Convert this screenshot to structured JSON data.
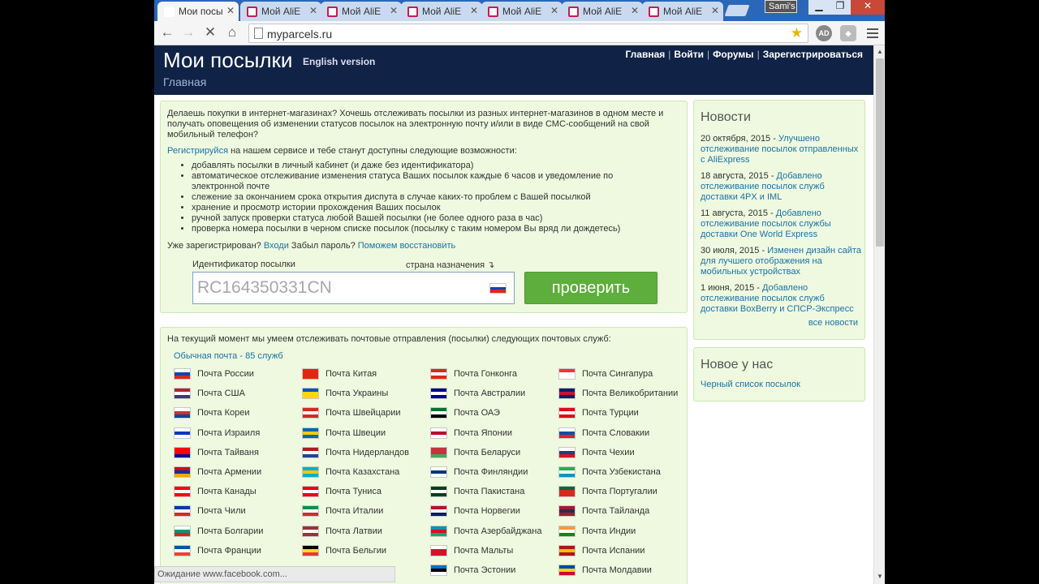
{
  "browser": {
    "tabs": [
      {
        "title": "Мои посы",
        "active": true
      },
      {
        "title": "Мой AliE",
        "active": false
      },
      {
        "title": "Мой AliE",
        "active": false
      },
      {
        "title": "Мой AliE",
        "active": false
      },
      {
        "title": "Мой AliE",
        "active": false
      },
      {
        "title": "Мой AliE",
        "active": false
      },
      {
        "title": "Мой AliE",
        "active": false
      }
    ],
    "user_badge": "Sami's",
    "url": "myparcels.ru",
    "status": "Ожидание www.facebook.com..."
  },
  "header": {
    "title": "Мои посылки",
    "english_link": "English version",
    "breadcrumb": "Главная",
    "nav": [
      "Главная",
      "Войти",
      "Форумы",
      "Зарегистрироваться"
    ]
  },
  "intro": {
    "text": "Делаешь покупки в интернет-магазинах? Хочешь отслеживать посылки из разных интернет-магазинов в одном месте и получать оповещения об изменении статусов посылок на электронную почту и/или в виде СМС-сообщений на свой мобильный телефон?",
    "register_link": "Регистрируйся",
    "register_rest": " на нашем сервисе и тебе станут доступны следующие возможности:",
    "features": [
      "добавлять посылки в личный кабинет (и даже без идентификатора)",
      "автоматическое отслеживание изменения статуса Ваших посылок каждые 6 часов и уведомление по электронной почте",
      "слежение за окончанием срока открытия диспута в случае каких-то проблем с Вашей посылкой",
      "хранение и просмотр истории прохождения Ваших посылок",
      "ручной запуск проверки статуса любой Вашей посылки (не более одного раза в час)",
      "проверка номера посылки в черном списке посылок (посылку с таким номером Вы вряд ли дождетесь)"
    ],
    "registered_q": "Уже зарегистрирован? ",
    "login_link": "Входи",
    "forgot_q": " Забыл пароль? ",
    "restore_link": "Поможем восстановить",
    "track_label": "Идентификатор посылки",
    "country_label": "страна назначения ↴",
    "track_placeholder": "RC164350331CN",
    "check_button": "проверить"
  },
  "news": {
    "title": "Новости",
    "items": [
      {
        "date": "20 октября, 2015 - ",
        "text": "Улучшено отслеживание посылок отправленных с AliExpress"
      },
      {
        "date": "18 августа, 2015 - ",
        "text": "Добавлено отслеживание посылок служб доставки 4PX и IML"
      },
      {
        "date": "11 августа, 2015 - ",
        "text": "Добавлено отслеживание посылок службы доставки One World Express"
      },
      {
        "date": "30 июля, 2015 - ",
        "text": "Изменен дизайн сайта для лучшего отображения на мобильных устройствах"
      },
      {
        "date": "1 июня, 2015 - ",
        "text": "Добавлено отслеживание посылок служб доставки BoxBerry и СПСР-Экспресс"
      }
    ],
    "all_link": "все новости"
  },
  "new_with_us": {
    "title": "Новое у нас",
    "link": "Черный список посылок"
  },
  "services": {
    "intro": "На текущий момент мы умеем отслеживать почтовые отправления (посылки) следующих почтовых служб:",
    "sub": "Обычная почта - 85 служб",
    "columns": [
      [
        {
          "name": "Почта России",
          "colors": [
            "#ffffff",
            "#1c3fa8",
            "#d52b1e"
          ]
        },
        {
          "name": "Почта США",
          "colors": [
            "#b22234",
            "#ffffff",
            "#3c3b6e"
          ]
        },
        {
          "name": "Почта Кореи",
          "colors": [
            "#ffffff",
            "#cd2e3a",
            "#0047a0"
          ]
        },
        {
          "name": "Почта Израиля",
          "colors": [
            "#ffffff",
            "#0038b8",
            "#ffffff"
          ]
        },
        {
          "name": "Почта Тайваня",
          "colors": [
            "#fe0000",
            "#fe0000",
            "#000095"
          ]
        },
        {
          "name": "Почта Армении",
          "colors": [
            "#d90012",
            "#0033a0",
            "#f2a800"
          ]
        },
        {
          "name": "Почта Канады",
          "colors": [
            "#ff0000",
            "#ffffff",
            "#ff0000"
          ]
        },
        {
          "name": "Почта Чили",
          "colors": [
            "#0039a6",
            "#ffffff",
            "#d52b1e"
          ]
        },
        {
          "name": "Почта Болгарии",
          "colors": [
            "#ffffff",
            "#00966e",
            "#d62612"
          ]
        },
        {
          "name": "Почта Франции",
          "colors": [
            "#0055a4",
            "#ffffff",
            "#ef4135"
          ]
        }
      ],
      [
        {
          "name": "Почта Китая",
          "colors": [
            "#de2910",
            "#de2910",
            "#de2910"
          ]
        },
        {
          "name": "Почта Украины",
          "colors": [
            "#0057b7",
            "#ffd700",
            "#ffd700"
          ]
        },
        {
          "name": "Почта Швейцарии",
          "colors": [
            "#d52b1e",
            "#ffffff",
            "#d52b1e"
          ]
        },
        {
          "name": "Почта Швеции",
          "colors": [
            "#006aa7",
            "#fecc00",
            "#006aa7"
          ]
        },
        {
          "name": "Почта Нидерландов",
          "colors": [
            "#ae1c28",
            "#ffffff",
            "#21468b"
          ]
        },
        {
          "name": "Почта Казахстана",
          "colors": [
            "#00afca",
            "#fec50c",
            "#00afca"
          ]
        },
        {
          "name": "Почта Туниса",
          "colors": [
            "#e70013",
            "#ffffff",
            "#e70013"
          ]
        },
        {
          "name": "Почта Италии",
          "colors": [
            "#009246",
            "#ffffff",
            "#ce2b37"
          ]
        },
        {
          "name": "Почта Латвии",
          "colors": [
            "#9e3039",
            "#ffffff",
            "#9e3039"
          ]
        },
        {
          "name": "Почта Бельгии",
          "colors": [
            "#000000",
            "#fdda24",
            "#ef3340"
          ]
        }
      ],
      [
        {
          "name": "Почта Гонконга",
          "colors": [
            "#de2910",
            "#ffffff",
            "#de2910"
          ]
        },
        {
          "name": "Почта Австралии",
          "colors": [
            "#00008b",
            "#ffffff",
            "#00008b"
          ]
        },
        {
          "name": "Почта ОАЭ",
          "colors": [
            "#00732f",
            "#ffffff",
            "#000000"
          ]
        },
        {
          "name": "Почта Японии",
          "colors": [
            "#ffffff",
            "#bc002d",
            "#ffffff"
          ]
        },
        {
          "name": "Почта Беларуси",
          "colors": [
            "#c8313e",
            "#c8313e",
            "#4aa657"
          ]
        },
        {
          "name": "Почта Финляндии",
          "colors": [
            "#ffffff",
            "#003580",
            "#ffffff"
          ]
        },
        {
          "name": "Почта Пакистана",
          "colors": [
            "#01411c",
            "#ffffff",
            "#01411c"
          ]
        },
        {
          "name": "Почта Норвегии",
          "colors": [
            "#ba0c2f",
            "#ffffff",
            "#00205b"
          ]
        },
        {
          "name": "Почта Азербайджана",
          "colors": [
            "#0092bc",
            "#e4002b",
            "#00af66"
          ]
        },
        {
          "name": "Почта Мальты",
          "colors": [
            "#ffffff",
            "#cf142b",
            "#cf142b"
          ]
        },
        {
          "name": "Почта Эстонии",
          "colors": [
            "#0072ce",
            "#000000",
            "#ffffff"
          ]
        }
      ],
      [
        {
          "name": "Почта Сингапура",
          "colors": [
            "#ef3340",
            "#ffffff",
            "#ffffff"
          ]
        },
        {
          "name": "Почта Великобритании",
          "colors": [
            "#012169",
            "#c8102e",
            "#012169"
          ]
        },
        {
          "name": "Почта Турции",
          "colors": [
            "#e30a17",
            "#ffffff",
            "#e30a17"
          ]
        },
        {
          "name": "Почта Словакии",
          "colors": [
            "#ffffff",
            "#0b4ea2",
            "#ee1c25"
          ]
        },
        {
          "name": "Почта Чехии",
          "colors": [
            "#ffffff",
            "#11457e",
            "#d7141a"
          ]
        },
        {
          "name": "Почта Узбекистана",
          "colors": [
            "#1eb53a",
            "#ffffff",
            "#0099b5"
          ]
        },
        {
          "name": "Почта Португалии",
          "colors": [
            "#046a38",
            "#da291c",
            "#da291c"
          ]
        },
        {
          "name": "Почта Тайланда",
          "colors": [
            "#a51931",
            "#2d2a4a",
            "#a51931"
          ]
        },
        {
          "name": "Почта Индии",
          "colors": [
            "#ff9933",
            "#ffffff",
            "#138808"
          ]
        },
        {
          "name": "Почта Испании",
          "colors": [
            "#aa151b",
            "#f1bf00",
            "#aa151b"
          ]
        },
        {
          "name": "Почта Молдавии",
          "colors": [
            "#0046ae",
            "#ffd200",
            "#cc092f"
          ]
        }
      ]
    ]
  }
}
